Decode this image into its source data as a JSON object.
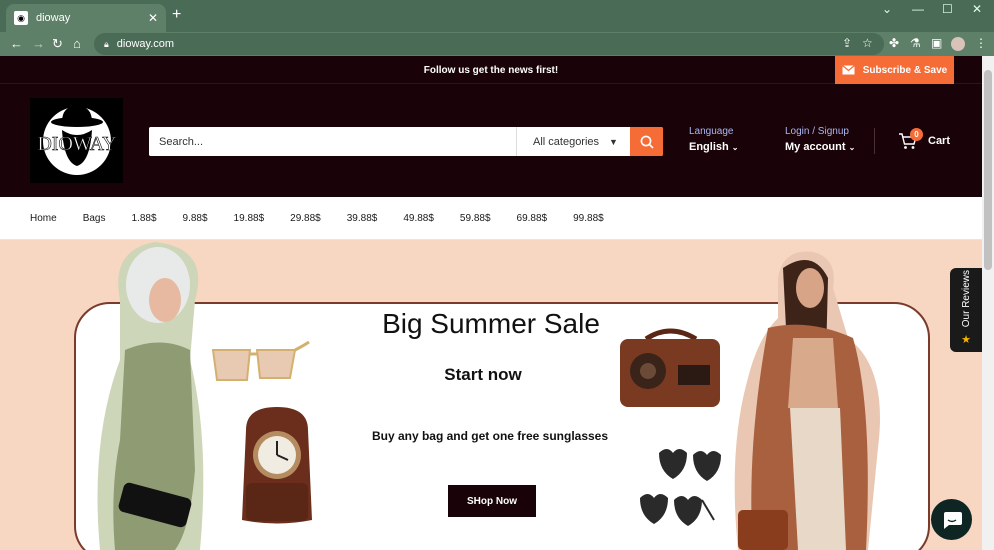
{
  "browser": {
    "tab_title": "dioway",
    "url": "dioway.com"
  },
  "announcement": {
    "message": "Follow us get the news first!",
    "subscribe_label": "Subscribe & Save"
  },
  "header": {
    "logo_text": "DIOWAY",
    "search_placeholder": "Search...",
    "category_label": "All categories",
    "language_label": "Language",
    "language_value": "English",
    "account_label": "Login / Signup",
    "account_value": "My account",
    "cart_label": "Cart",
    "cart_count": "0"
  },
  "menu": {
    "items": [
      "Home",
      "Bags",
      "1.88$",
      "9.88$",
      "19.88$",
      "29.88$",
      "39.88$",
      "49.88$",
      "59.88$",
      "69.88$",
      "99.88$"
    ]
  },
  "hero": {
    "title": "Big Summer Sale",
    "subtitle": "Start now",
    "offer": "Buy any bag and get one free sunglasses",
    "cta": "SHop Now"
  },
  "reviews_tab": "Our Reviews",
  "colors": {
    "accent": "#f66c37",
    "header_bg": "#1a0308",
    "hero_bg": "#f7d6c2"
  }
}
